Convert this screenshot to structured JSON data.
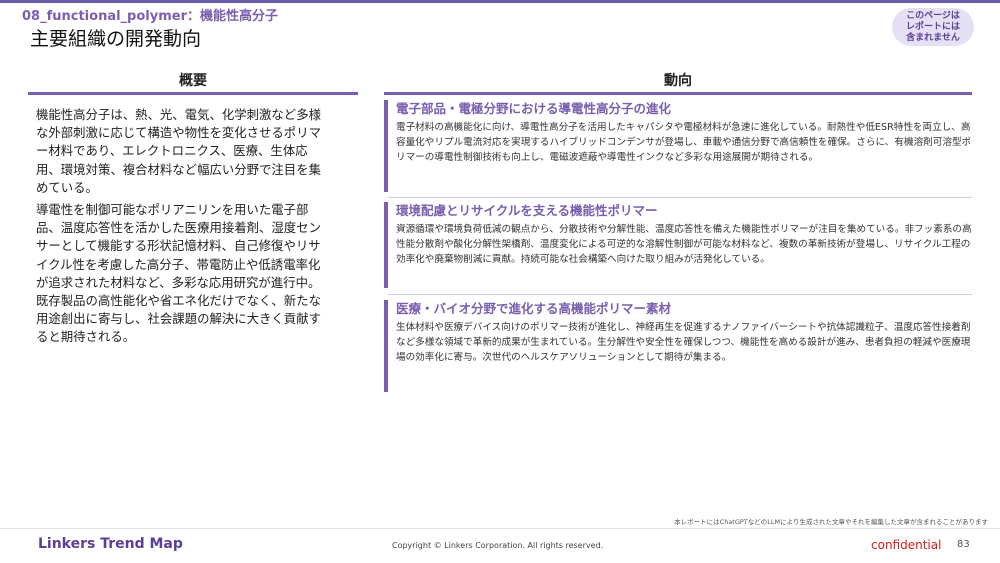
{
  "header": {
    "category": "08_functional_polymer：機能性高分子",
    "title": "主要組織の開発動向",
    "badge_lines": [
      "このページは",
      "レポートには",
      "含まれません"
    ]
  },
  "overview": {
    "heading": "概要",
    "paragraphs": [
      "機能性高分子は、熱、光、電気、化学刺激など多様な外部刺激に応じて構造や物性を変化させるポリマー材料であり、エレクトロニクス、医療、生体応用、環境対策、複合材料など幅広い分野で注目を集めている。",
      "導電性を制御可能なポリアニリンを用いた電子部品、温度応答性を活かした医療用接着剤、湿度センサーとして機能する形状記憶材料、自己修復やリサイクル性を考慮した高分子、帯電防止や低誘電率化が追求された材料など、多彩な応用研究が進行中。既存製品の高性能化や省エネ化だけでなく、新たな用途創出に寄与し、社会課題の解決に大きく貢献すると期待される。"
    ]
  },
  "trends": {
    "heading": "動向",
    "items": [
      {
        "title": "電子部品・電極分野における導電性高分子の進化",
        "body": "電子材料の高機能化に向け、導電性高分子を活用したキャパシタや電極材料が急速に進化している。耐熱性や低ESR特性を両立し、高容量化やリプル電流対応を実現するハイブリッドコンデンサが登場し、車載や通信分野で高信頼性を確保。さらに、有機溶剤可溶型ポリマーの導電性制御技術も向上し、電磁波遮蔽や導電性インクなど多彩な用途展開が期待される。"
      },
      {
        "title": "環境配慮とリサイクルを支える機能性ポリマー",
        "body": "資源循環や環境負荷低減の観点から、分散技術や分解性能、温度応答性を備えた機能性ポリマーが注目を集めている。非フッ素系の高性能分散剤や酸化分解性架橋剤、温度変化による可逆的な溶解性制御が可能な材料など、複数の革新技術が登場し、リサイクル工程の効率化や廃棄物削減に貢献。持続可能な社会構築へ向けた取り組みが活発化している。"
      },
      {
        "title": "医療・バイオ分野で進化する高機能ポリマー素材",
        "body": "生体材料や医療デバイス向けのポリマー技術が進化し、神経再生を促進するナノファイバーシートや抗体認識粒子、温度応答性接着剤など多様な領域で革新的成果が生まれている。生分解性や安全性を確保しつつ、機能性を高める設計が進み、患者負担の軽減や医療現場の効率化に寄与。次世代のヘルスケアソリューションとして期待が集まる。"
      }
    ]
  },
  "footer": {
    "disclaimer": "本レポートにはChatGPTなどのLLMにより生成された文章やそれを編集した文章が含まれることがあります",
    "logo": "Linkers Trend Map",
    "copyright": "Copyright © Linkers Corporation. All rights reserved.",
    "confidential": "confidential",
    "page_number": "83"
  },
  "colors": {
    "accent": "#7a5fb0",
    "confidential": "#d61a1a",
    "badge_bg": "#e6e0f4"
  }
}
